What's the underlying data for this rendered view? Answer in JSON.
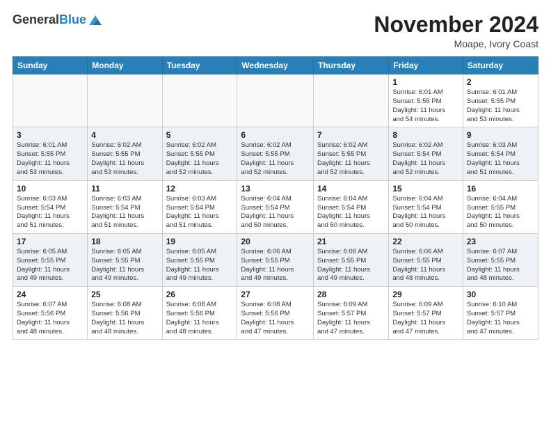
{
  "header": {
    "logo_general": "General",
    "logo_blue": "Blue",
    "month_title": "November 2024",
    "location": "Moape, Ivory Coast"
  },
  "days_of_week": [
    "Sunday",
    "Monday",
    "Tuesday",
    "Wednesday",
    "Thursday",
    "Friday",
    "Saturday"
  ],
  "weeks": [
    {
      "days": [
        {
          "num": "",
          "info": ""
        },
        {
          "num": "",
          "info": ""
        },
        {
          "num": "",
          "info": ""
        },
        {
          "num": "",
          "info": ""
        },
        {
          "num": "",
          "info": ""
        },
        {
          "num": "1",
          "info": "Sunrise: 6:01 AM\nSunset: 5:55 PM\nDaylight: 11 hours\nand 54 minutes."
        },
        {
          "num": "2",
          "info": "Sunrise: 6:01 AM\nSunset: 5:55 PM\nDaylight: 11 hours\nand 53 minutes."
        }
      ]
    },
    {
      "days": [
        {
          "num": "3",
          "info": "Sunrise: 6:01 AM\nSunset: 5:55 PM\nDaylight: 11 hours\nand 53 minutes."
        },
        {
          "num": "4",
          "info": "Sunrise: 6:02 AM\nSunset: 5:55 PM\nDaylight: 11 hours\nand 53 minutes."
        },
        {
          "num": "5",
          "info": "Sunrise: 6:02 AM\nSunset: 5:55 PM\nDaylight: 11 hours\nand 52 minutes."
        },
        {
          "num": "6",
          "info": "Sunrise: 6:02 AM\nSunset: 5:55 PM\nDaylight: 11 hours\nand 52 minutes."
        },
        {
          "num": "7",
          "info": "Sunrise: 6:02 AM\nSunset: 5:55 PM\nDaylight: 11 hours\nand 52 minutes."
        },
        {
          "num": "8",
          "info": "Sunrise: 6:02 AM\nSunset: 5:54 PM\nDaylight: 11 hours\nand 52 minutes."
        },
        {
          "num": "9",
          "info": "Sunrise: 6:03 AM\nSunset: 5:54 PM\nDaylight: 11 hours\nand 51 minutes."
        }
      ]
    },
    {
      "days": [
        {
          "num": "10",
          "info": "Sunrise: 6:03 AM\nSunset: 5:54 PM\nDaylight: 11 hours\nand 51 minutes."
        },
        {
          "num": "11",
          "info": "Sunrise: 6:03 AM\nSunset: 5:54 PM\nDaylight: 11 hours\nand 51 minutes."
        },
        {
          "num": "12",
          "info": "Sunrise: 6:03 AM\nSunset: 5:54 PM\nDaylight: 11 hours\nand 51 minutes."
        },
        {
          "num": "13",
          "info": "Sunrise: 6:04 AM\nSunset: 5:54 PM\nDaylight: 11 hours\nand 50 minutes."
        },
        {
          "num": "14",
          "info": "Sunrise: 6:04 AM\nSunset: 5:54 PM\nDaylight: 11 hours\nand 50 minutes."
        },
        {
          "num": "15",
          "info": "Sunrise: 6:04 AM\nSunset: 5:54 PM\nDaylight: 11 hours\nand 50 minutes."
        },
        {
          "num": "16",
          "info": "Sunrise: 6:04 AM\nSunset: 5:55 PM\nDaylight: 11 hours\nand 50 minutes."
        }
      ]
    },
    {
      "days": [
        {
          "num": "17",
          "info": "Sunrise: 6:05 AM\nSunset: 5:55 PM\nDaylight: 11 hours\nand 49 minutes."
        },
        {
          "num": "18",
          "info": "Sunrise: 6:05 AM\nSunset: 5:55 PM\nDaylight: 11 hours\nand 49 minutes."
        },
        {
          "num": "19",
          "info": "Sunrise: 6:05 AM\nSunset: 5:55 PM\nDaylight: 11 hours\nand 49 minutes."
        },
        {
          "num": "20",
          "info": "Sunrise: 6:06 AM\nSunset: 5:55 PM\nDaylight: 11 hours\nand 49 minutes."
        },
        {
          "num": "21",
          "info": "Sunrise: 6:06 AM\nSunset: 5:55 PM\nDaylight: 11 hours\nand 49 minutes."
        },
        {
          "num": "22",
          "info": "Sunrise: 6:06 AM\nSunset: 5:55 PM\nDaylight: 11 hours\nand 48 minutes."
        },
        {
          "num": "23",
          "info": "Sunrise: 6:07 AM\nSunset: 5:55 PM\nDaylight: 11 hours\nand 48 minutes."
        }
      ]
    },
    {
      "days": [
        {
          "num": "24",
          "info": "Sunrise: 6:07 AM\nSunset: 5:56 PM\nDaylight: 11 hours\nand 48 minutes."
        },
        {
          "num": "25",
          "info": "Sunrise: 6:08 AM\nSunset: 5:56 PM\nDaylight: 11 hours\nand 48 minutes."
        },
        {
          "num": "26",
          "info": "Sunrise: 6:08 AM\nSunset: 5:56 PM\nDaylight: 11 hours\nand 48 minutes."
        },
        {
          "num": "27",
          "info": "Sunrise: 6:08 AM\nSunset: 5:56 PM\nDaylight: 11 hours\nand 47 minutes."
        },
        {
          "num": "28",
          "info": "Sunrise: 6:09 AM\nSunset: 5:57 PM\nDaylight: 11 hours\nand 47 minutes."
        },
        {
          "num": "29",
          "info": "Sunrise: 6:09 AM\nSunset: 5:57 PM\nDaylight: 11 hours\nand 47 minutes."
        },
        {
          "num": "30",
          "info": "Sunrise: 6:10 AM\nSunset: 5:57 PM\nDaylight: 11 hours\nand 47 minutes."
        }
      ]
    }
  ]
}
